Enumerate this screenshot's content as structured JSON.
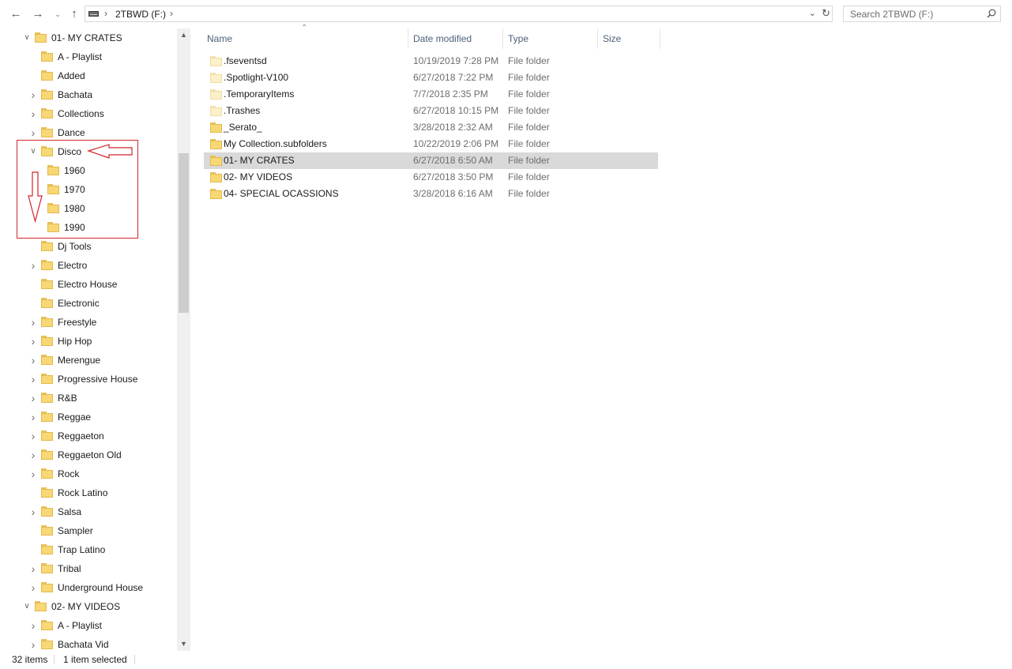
{
  "address": {
    "crumb": "2TBWD (F:)",
    "separator": "›",
    "search_placeholder": "Search 2TBWD (F:)"
  },
  "nav": {
    "back": "←",
    "forward": "→",
    "recent": "⌄",
    "up": "↑",
    "tree": [
      {
        "label": "01- MY CRATES",
        "chevron": "open"
      },
      {
        "label": "A - Playlist",
        "chevron": "none"
      },
      {
        "label": "Added",
        "chevron": "none"
      },
      {
        "label": "Bachata",
        "chevron": "closed"
      },
      {
        "label": "Collections",
        "chevron": "closed"
      },
      {
        "label": "Dance",
        "chevron": "closed"
      },
      {
        "label": "Disco",
        "chevron": "open"
      },
      {
        "label": "1960",
        "chevron": "none"
      },
      {
        "label": "1970",
        "chevron": "none"
      },
      {
        "label": "1980",
        "chevron": "none"
      },
      {
        "label": "1990",
        "chevron": "none"
      },
      {
        "label": "Dj Tools",
        "chevron": "none"
      },
      {
        "label": "Electro",
        "chevron": "closed"
      },
      {
        "label": "Electro House",
        "chevron": "none"
      },
      {
        "label": "Electronic",
        "chevron": "none"
      },
      {
        "label": "Freestyle",
        "chevron": "closed"
      },
      {
        "label": "Hip Hop",
        "chevron": "closed"
      },
      {
        "label": "Merengue",
        "chevron": "closed"
      },
      {
        "label": "Progressive House",
        "chevron": "closed"
      },
      {
        "label": "R&B",
        "chevron": "closed"
      },
      {
        "label": "Reggae",
        "chevron": "closed"
      },
      {
        "label": "Reggaeton",
        "chevron": "closed"
      },
      {
        "label": "Reggaeton Old",
        "chevron": "closed"
      },
      {
        "label": "Rock",
        "chevron": "closed"
      },
      {
        "label": "Rock Latino",
        "chevron": "none"
      },
      {
        "label": "Salsa",
        "chevron": "closed"
      },
      {
        "label": "Sampler",
        "chevron": "none"
      },
      {
        "label": "Trap Latino",
        "chevron": "none"
      },
      {
        "label": "Tribal",
        "chevron": "closed"
      },
      {
        "label": "Underground House",
        "chevron": "closed"
      },
      {
        "label": "02- MY VIDEOS",
        "chevron": "open"
      },
      {
        "label": "A - Playlist",
        "chevron": "closed"
      },
      {
        "label": "Bachata Vid",
        "chevron": "closed"
      }
    ]
  },
  "columns": {
    "name": "Name",
    "date": "Date modified",
    "type": "Type",
    "size": "Size"
  },
  "files": [
    {
      "name": ".fseventsd",
      "date": "10/19/2019 7:28 PM",
      "type": "File folder",
      "hidden": true,
      "selected": false
    },
    {
      "name": ".Spotlight-V100",
      "date": "6/27/2018 7:22 PM",
      "type": "File folder",
      "hidden": true,
      "selected": false
    },
    {
      "name": ".TemporaryItems",
      "date": "7/7/2018 2:35 PM",
      "type": "File folder",
      "hidden": true,
      "selected": false
    },
    {
      "name": ".Trashes",
      "date": "6/27/2018 10:15 PM",
      "type": "File folder",
      "hidden": true,
      "selected": false
    },
    {
      "name": "_Serato_",
      "date": "3/28/2018 2:32 AM",
      "type": "File folder",
      "hidden": false,
      "selected": false
    },
    {
      "name": "My Collection.subfolders",
      "date": "10/22/2019 2:06 PM",
      "type": "File folder",
      "hidden": false,
      "selected": false
    },
    {
      "name": "01- MY CRATES",
      "date": "6/27/2018 6:50 AM",
      "type": "File folder",
      "hidden": false,
      "selected": true
    },
    {
      "name": "02- MY VIDEOS",
      "date": "6/27/2018 3:50 PM",
      "type": "File folder",
      "hidden": false,
      "selected": false
    },
    {
      "name": "04- SPECIAL OCASSIONS",
      "date": "3/28/2018 6:16 AM",
      "type": "File folder",
      "hidden": false,
      "selected": false
    }
  ],
  "status": {
    "items": "32 items",
    "selected": "1 item selected"
  },
  "colors": {
    "folder": "#f8d775",
    "selection": "#d9d9d9",
    "annotation": "#d0262b"
  }
}
